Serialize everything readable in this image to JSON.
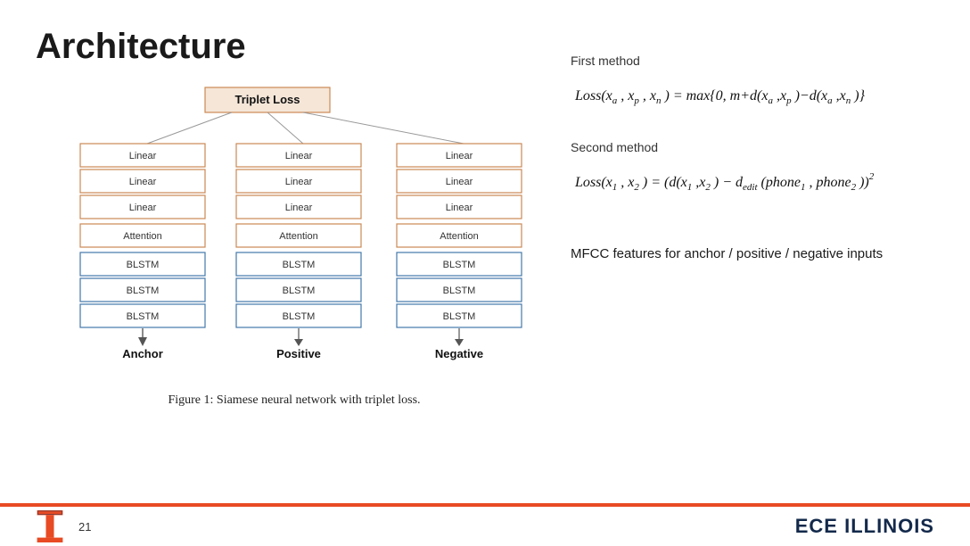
{
  "page": {
    "title": "Architecture",
    "page_number": "21"
  },
  "footer": {
    "brand": "ECE ILLINOIS",
    "page_number": "21"
  },
  "diagram": {
    "triplet_loss_label": "Triplet Loss",
    "columns": [
      "Anchor",
      "Positive",
      "Negative"
    ],
    "layers": [
      {
        "type": "Linear",
        "count": 3
      },
      {
        "type": "Attention",
        "count": 1
      },
      {
        "type": "BLSTM",
        "count": 3
      }
    ],
    "col1_layers": [
      "Linear",
      "Linear",
      "Linear",
      "Attention",
      "BLSTM",
      "BLSTM",
      "BLSTM"
    ],
    "col2_layers": [
      "Linear",
      "Linear",
      "Linear",
      "Attention",
      "BLSTM",
      "BLSTM",
      "BLSTM"
    ],
    "col3_layers": [
      "Linear",
      "Linear",
      "Linear",
      "Attention",
      "BLSTM",
      "BLSTM",
      "BLSTM"
    ]
  },
  "figure_caption": "Figure 1: Siamese neural network with triplet loss.",
  "right_panel": {
    "first_method_label": "First method",
    "first_method_formula": "Loss(xa, xp, xn) = max{0, m+d(xa,xp)−d(xa,xn)}",
    "second_method_label": "Second method",
    "second_method_formula": "Loss(x1, x2) = (d(x1,x2) − dedit(phone1, phone2))²",
    "mfcc_text": "MFCC features for anchor / positive / negative inputs"
  },
  "colors": {
    "orange": "#E84A23",
    "dark_blue": "#13294B",
    "box_border": "#cc6633",
    "box_bg": "#fff",
    "header_bg": "#e8d0b8"
  }
}
